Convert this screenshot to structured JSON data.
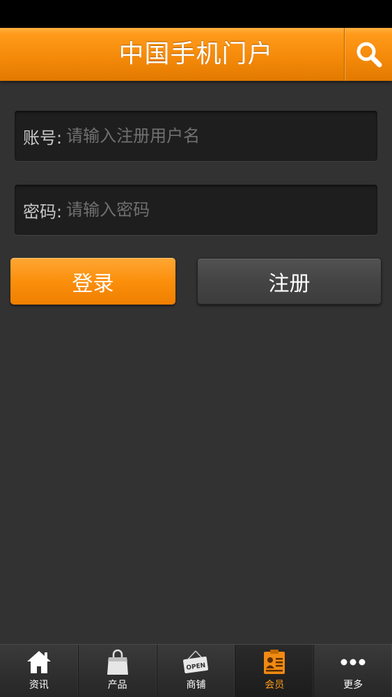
{
  "header": {
    "title": "中国手机门户",
    "search_icon": "search-icon"
  },
  "login_form": {
    "account": {
      "label": "账号:",
      "value": "",
      "placeholder": "请输入注册用户名"
    },
    "password": {
      "label": "密码:",
      "value": "",
      "placeholder": "请输入密码"
    },
    "login_label": "登录",
    "register_label": "注册"
  },
  "tab_bar": {
    "active_index": 3,
    "items": [
      {
        "label": "资讯",
        "icon": "home-icon"
      },
      {
        "label": "产品",
        "icon": "shopping-bag-icon"
      },
      {
        "label": "商铺",
        "icon": "open-sign-icon",
        "icon_text": "OPEN"
      },
      {
        "label": "会员",
        "icon": "member-card-icon"
      },
      {
        "label": "更多",
        "icon": "more-dots-icon"
      }
    ]
  },
  "colors": {
    "accent": "#f58a0a",
    "background": "#323232",
    "field_background": "#1e1e1e",
    "active_tab_label": "#ff9a1a"
  }
}
